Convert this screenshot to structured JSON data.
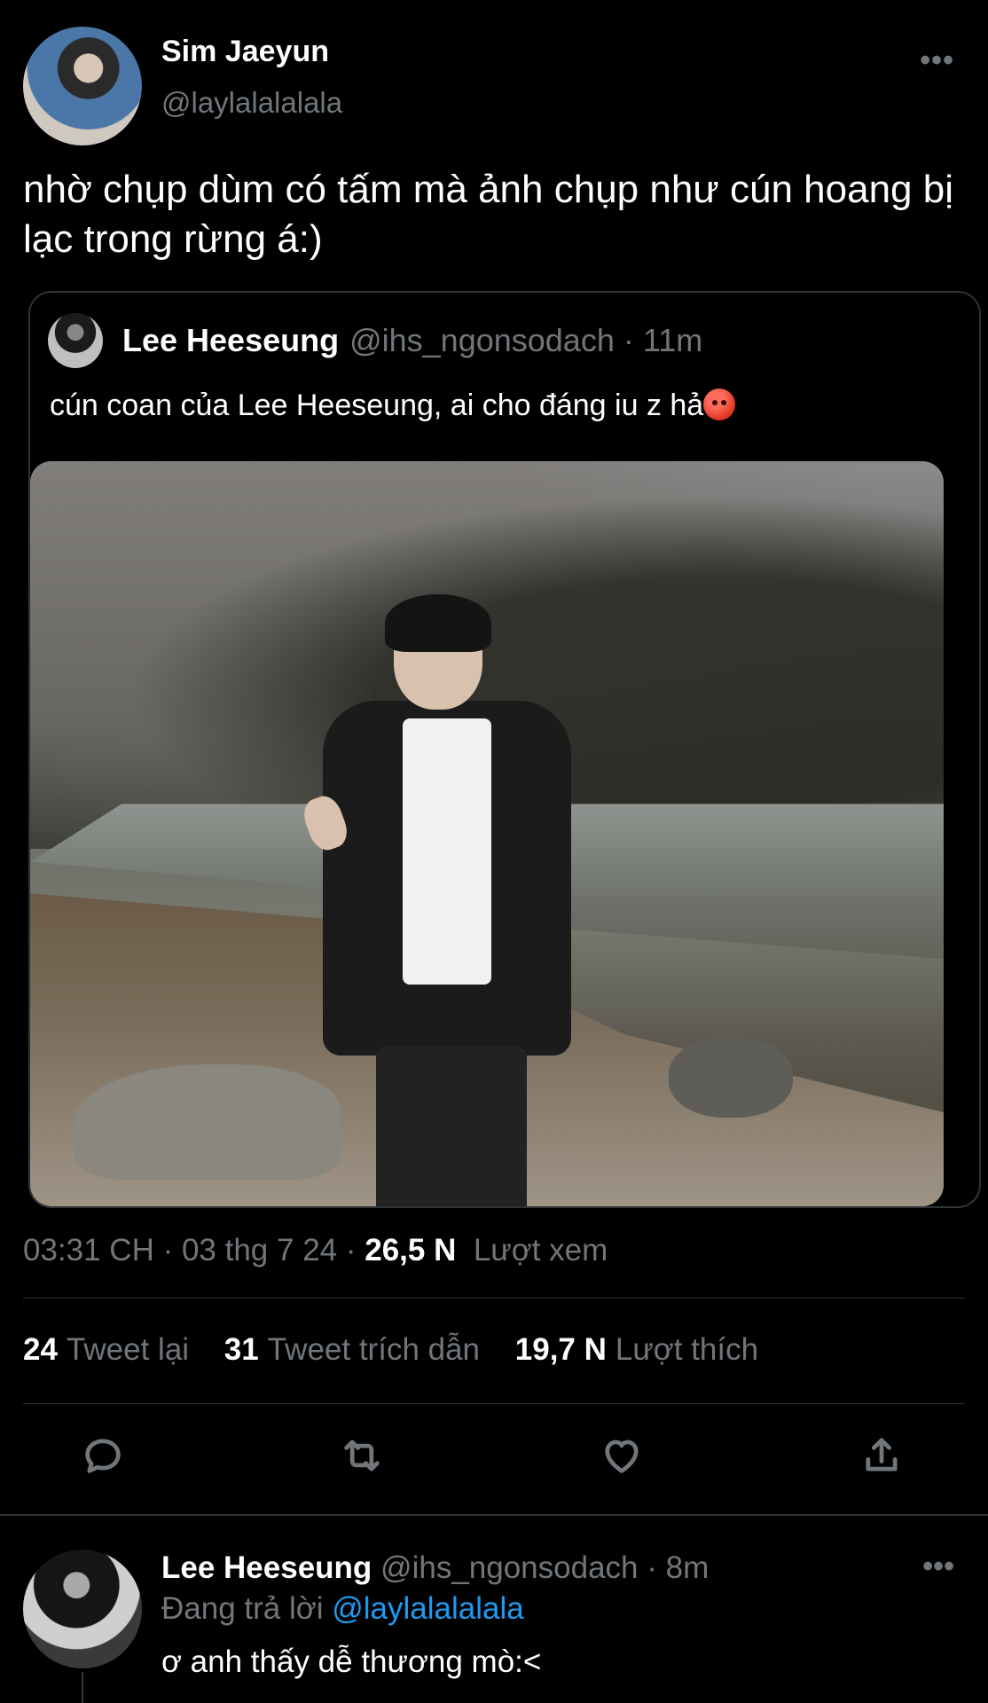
{
  "tweet": {
    "author_name": "Sim Jaeyun",
    "author_handle": "@laylalalalala",
    "more_label": "•••",
    "text": "nhờ chụp dùm có tấm mà ảnh chụp như cún hoang bị lạc trong rừng á:)",
    "timestamp": "03:31 CH · 03 thg 7 24 · ",
    "views_count": "26,5 N",
    "views_label": "Lượt xem"
  },
  "quote": {
    "author_name": "Lee Heeseung",
    "meta": "@ihs_ngonsodach · 11m",
    "text": "cún coan của Lee Heeseung, ai cho đáng iu z hả",
    "emoji": "angry-face-emoji"
  },
  "stats": {
    "retweets_count": "24",
    "retweets_label": "Tweet lại",
    "quotes_count": "31",
    "quotes_label": "Tweet trích dẫn",
    "likes_count": "19,7 N",
    "likes_label": "Lượt thích"
  },
  "actions": [
    "reply-icon",
    "retweet-icon",
    "like-icon",
    "share-icon"
  ],
  "reply": {
    "author_name": "Lee Heeseung",
    "meta": "@ihs_ngonsodach · 8m",
    "replying_prefix": "Đang trả lời ",
    "replying_to": "@laylalalalala",
    "text": "ơ anh thấy dễ thương mò:<",
    "more_label": "•••"
  },
  "colors": {
    "background": "#000000",
    "text_primary": "#e7e9ea",
    "text_secondary": "#71767b",
    "divider": "#2f3336",
    "link": "#1d9bf0"
  }
}
